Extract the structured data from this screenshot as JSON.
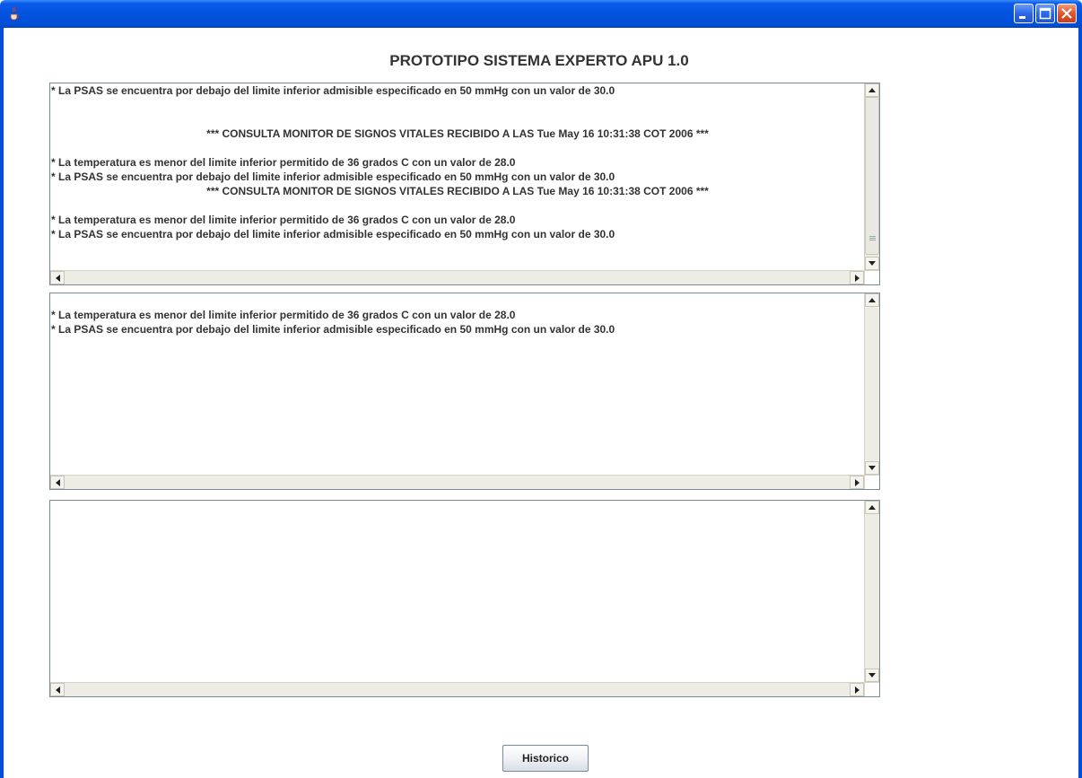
{
  "window": {
    "app_icon": "java-cup-icon",
    "controls": [
      "minimize-icon",
      "maximize-icon",
      "close-icon"
    ]
  },
  "title": "PROTOTIPO SISTEMA EXPERTO APU 1.0",
  "panes": [
    {
      "lines": [
        {
          "text": "* La PSAS se encuentra por debajo del limite inferior admisible especificado en 50 mmHg con un valor de 30.0",
          "align": "left"
        },
        {
          "text": "",
          "align": "left"
        },
        {
          "text": "",
          "align": "left"
        },
        {
          "text": "*** CONSULTA MONITOR DE SIGNOS VITALES RECIBIDO A LAS Tue May 16 10:31:38 COT 2006 ***",
          "align": "center"
        },
        {
          "text": "",
          "align": "left"
        },
        {
          "text": "* La temperatura es menor del limite inferior permitido de 36 grados C con un valor de 28.0",
          "align": "left"
        },
        {
          "text": "* La PSAS se encuentra por debajo del limite inferior admisible especificado en 50 mmHg con un valor de 30.0",
          "align": "left"
        },
        {
          "text": "*** CONSULTA MONITOR DE SIGNOS VITALES RECIBIDO A LAS Tue May 16 10:31:38 COT 2006 ***",
          "align": "center"
        },
        {
          "text": "",
          "align": "left"
        },
        {
          "text": "* La temperatura es menor del limite inferior permitido de 36 grados C con un valor de 28.0",
          "align": "left"
        },
        {
          "text": "* La PSAS se encuentra por debajo del limite inferior admisible especificado en 50 mmHg con un valor de 30.0",
          "align": "left"
        }
      ]
    },
    {
      "lines": [
        {
          "text": "",
          "align": "left"
        },
        {
          "text": "* La temperatura es menor del limite inferior permitido de 36 grados C con un valor de 28.0",
          "align": "left"
        },
        {
          "text": "* La PSAS se encuentra por debajo del limite inferior admisible especificado en 50 mmHg con un valor de 30.0",
          "align": "left"
        }
      ]
    },
    {
      "lines": []
    }
  ],
  "button": {
    "label": "Historico"
  }
}
